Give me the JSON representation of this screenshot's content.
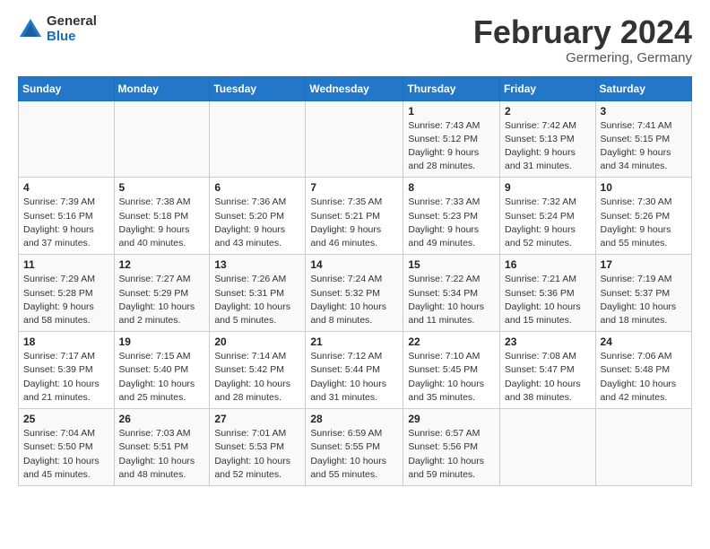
{
  "logo": {
    "general": "General",
    "blue": "Blue"
  },
  "header": {
    "title": "February 2024",
    "subtitle": "Germering, Germany"
  },
  "weekdays": [
    "Sunday",
    "Monday",
    "Tuesday",
    "Wednesday",
    "Thursday",
    "Friday",
    "Saturday"
  ],
  "weeks": [
    [
      {
        "day": "",
        "info": ""
      },
      {
        "day": "",
        "info": ""
      },
      {
        "day": "",
        "info": ""
      },
      {
        "day": "",
        "info": ""
      },
      {
        "day": "1",
        "info": "Sunrise: 7:43 AM\nSunset: 5:12 PM\nDaylight: 9 hours and 28 minutes."
      },
      {
        "day": "2",
        "info": "Sunrise: 7:42 AM\nSunset: 5:13 PM\nDaylight: 9 hours and 31 minutes."
      },
      {
        "day": "3",
        "info": "Sunrise: 7:41 AM\nSunset: 5:15 PM\nDaylight: 9 hours and 34 minutes."
      }
    ],
    [
      {
        "day": "4",
        "info": "Sunrise: 7:39 AM\nSunset: 5:16 PM\nDaylight: 9 hours and 37 minutes."
      },
      {
        "day": "5",
        "info": "Sunrise: 7:38 AM\nSunset: 5:18 PM\nDaylight: 9 hours and 40 minutes."
      },
      {
        "day": "6",
        "info": "Sunrise: 7:36 AM\nSunset: 5:20 PM\nDaylight: 9 hours and 43 minutes."
      },
      {
        "day": "7",
        "info": "Sunrise: 7:35 AM\nSunset: 5:21 PM\nDaylight: 9 hours and 46 minutes."
      },
      {
        "day": "8",
        "info": "Sunrise: 7:33 AM\nSunset: 5:23 PM\nDaylight: 9 hours and 49 minutes."
      },
      {
        "day": "9",
        "info": "Sunrise: 7:32 AM\nSunset: 5:24 PM\nDaylight: 9 hours and 52 minutes."
      },
      {
        "day": "10",
        "info": "Sunrise: 7:30 AM\nSunset: 5:26 PM\nDaylight: 9 hours and 55 minutes."
      }
    ],
    [
      {
        "day": "11",
        "info": "Sunrise: 7:29 AM\nSunset: 5:28 PM\nDaylight: 9 hours and 58 minutes."
      },
      {
        "day": "12",
        "info": "Sunrise: 7:27 AM\nSunset: 5:29 PM\nDaylight: 10 hours and 2 minutes."
      },
      {
        "day": "13",
        "info": "Sunrise: 7:26 AM\nSunset: 5:31 PM\nDaylight: 10 hours and 5 minutes."
      },
      {
        "day": "14",
        "info": "Sunrise: 7:24 AM\nSunset: 5:32 PM\nDaylight: 10 hours and 8 minutes."
      },
      {
        "day": "15",
        "info": "Sunrise: 7:22 AM\nSunset: 5:34 PM\nDaylight: 10 hours and 11 minutes."
      },
      {
        "day": "16",
        "info": "Sunrise: 7:21 AM\nSunset: 5:36 PM\nDaylight: 10 hours and 15 minutes."
      },
      {
        "day": "17",
        "info": "Sunrise: 7:19 AM\nSunset: 5:37 PM\nDaylight: 10 hours and 18 minutes."
      }
    ],
    [
      {
        "day": "18",
        "info": "Sunrise: 7:17 AM\nSunset: 5:39 PM\nDaylight: 10 hours and 21 minutes."
      },
      {
        "day": "19",
        "info": "Sunrise: 7:15 AM\nSunset: 5:40 PM\nDaylight: 10 hours and 25 minutes."
      },
      {
        "day": "20",
        "info": "Sunrise: 7:14 AM\nSunset: 5:42 PM\nDaylight: 10 hours and 28 minutes."
      },
      {
        "day": "21",
        "info": "Sunrise: 7:12 AM\nSunset: 5:44 PM\nDaylight: 10 hours and 31 minutes."
      },
      {
        "day": "22",
        "info": "Sunrise: 7:10 AM\nSunset: 5:45 PM\nDaylight: 10 hours and 35 minutes."
      },
      {
        "day": "23",
        "info": "Sunrise: 7:08 AM\nSunset: 5:47 PM\nDaylight: 10 hours and 38 minutes."
      },
      {
        "day": "24",
        "info": "Sunrise: 7:06 AM\nSunset: 5:48 PM\nDaylight: 10 hours and 42 minutes."
      }
    ],
    [
      {
        "day": "25",
        "info": "Sunrise: 7:04 AM\nSunset: 5:50 PM\nDaylight: 10 hours and 45 minutes."
      },
      {
        "day": "26",
        "info": "Sunrise: 7:03 AM\nSunset: 5:51 PM\nDaylight: 10 hours and 48 minutes."
      },
      {
        "day": "27",
        "info": "Sunrise: 7:01 AM\nSunset: 5:53 PM\nDaylight: 10 hours and 52 minutes."
      },
      {
        "day": "28",
        "info": "Sunrise: 6:59 AM\nSunset: 5:55 PM\nDaylight: 10 hours and 55 minutes."
      },
      {
        "day": "29",
        "info": "Sunrise: 6:57 AM\nSunset: 5:56 PM\nDaylight: 10 hours and 59 minutes."
      },
      {
        "day": "",
        "info": ""
      },
      {
        "day": "",
        "info": ""
      }
    ]
  ]
}
